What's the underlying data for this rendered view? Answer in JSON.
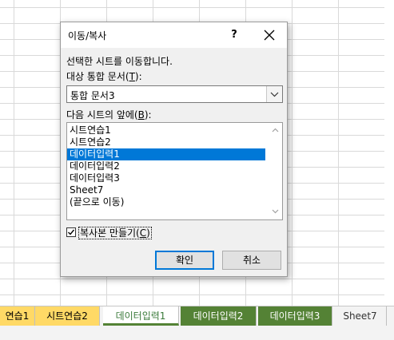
{
  "dialog": {
    "title": "이동/복사",
    "help_label": "?",
    "prompt": "선택한 시트를 이동합니다.",
    "to_book_label_pre": "대상 통합 문서(",
    "to_book_label_key": "T",
    "to_book_label_post": "):",
    "to_book_value": "통합 문서3",
    "before_sheet_label_pre": "다음 시트의 앞에(",
    "before_sheet_label_key": "B",
    "before_sheet_label_post": "):",
    "sheet_list": [
      "시트연습1",
      "시트연습2",
      "데이터입력1",
      "데이터입력2",
      "데이터입력3",
      "Sheet7",
      "(끝으로 이동)"
    ],
    "selected_index": 2,
    "copy_label_pre": "복사본 만들기(",
    "copy_label_key": "C",
    "copy_label_post": ")",
    "copy_checked": true,
    "ok_label": "확인",
    "cancel_label": "취소"
  },
  "tabs": [
    {
      "label": "연습1",
      "style": "yellow"
    },
    {
      "label": "시트연습2",
      "style": "yellow"
    },
    {
      "label": "데이터입력1",
      "style": "active"
    },
    {
      "label": "데이터입력2",
      "style": "green"
    },
    {
      "label": "데이터입력3",
      "style": "green"
    },
    {
      "label": "Sheet7",
      "style": "plain"
    }
  ],
  "colors": {
    "selection": "#0078d7",
    "tab_yellow": "#ffd966",
    "tab_green": "#548235"
  }
}
